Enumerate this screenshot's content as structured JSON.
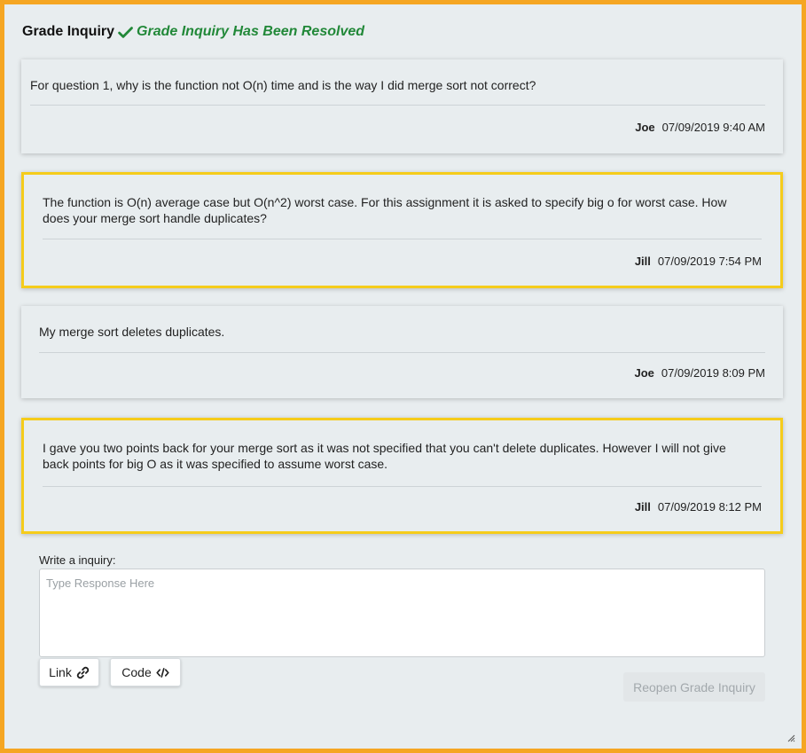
{
  "header": {
    "title": "Grade Inquiry",
    "status": "Grade Inquiry Has Been Resolved",
    "status_color": "#218838"
  },
  "messages": [
    {
      "body": "For question 1,  why is the function not O(n) time and is the way I did merge sort not correct?",
      "author": "Joe",
      "timestamp": "07/09/2019 9:40 AM",
      "highlighted": false
    },
    {
      "body": "The function is O(n) average case but O(n^2) worst case. For this assignment it is asked to specify big o for worst case. How does your merge sort  handle duplicates?",
      "author": "Jill",
      "timestamp": "07/09/2019 7:54 PM",
      "highlighted": true
    },
    {
      "body": "My merge sort deletes duplicates.",
      "author": "Joe",
      "timestamp": "07/09/2019 8:09 PM",
      "highlighted": false
    },
    {
      "body": "I gave you two points back for your merge sort as it was not specified that you can't delete duplicates. However I will not give back points for big O as it was specified to assume worst case.",
      "author": "Jill",
      "timestamp": "07/09/2019 8:12 PM",
      "highlighted": true
    }
  ],
  "compose": {
    "label": "Write a inquiry:",
    "value": "",
    "placeholder": "Type Response Here",
    "link_button": "Link",
    "code_button": "Code",
    "reopen_button": "Reopen Grade Inquiry"
  },
  "icons": {
    "check": "check-icon",
    "link": "link-icon",
    "code": "code-icon",
    "resize": "resize-grip-icon"
  },
  "colors": {
    "frame_border": "#f5a623",
    "highlight_border": "#f5cc1b"
  }
}
